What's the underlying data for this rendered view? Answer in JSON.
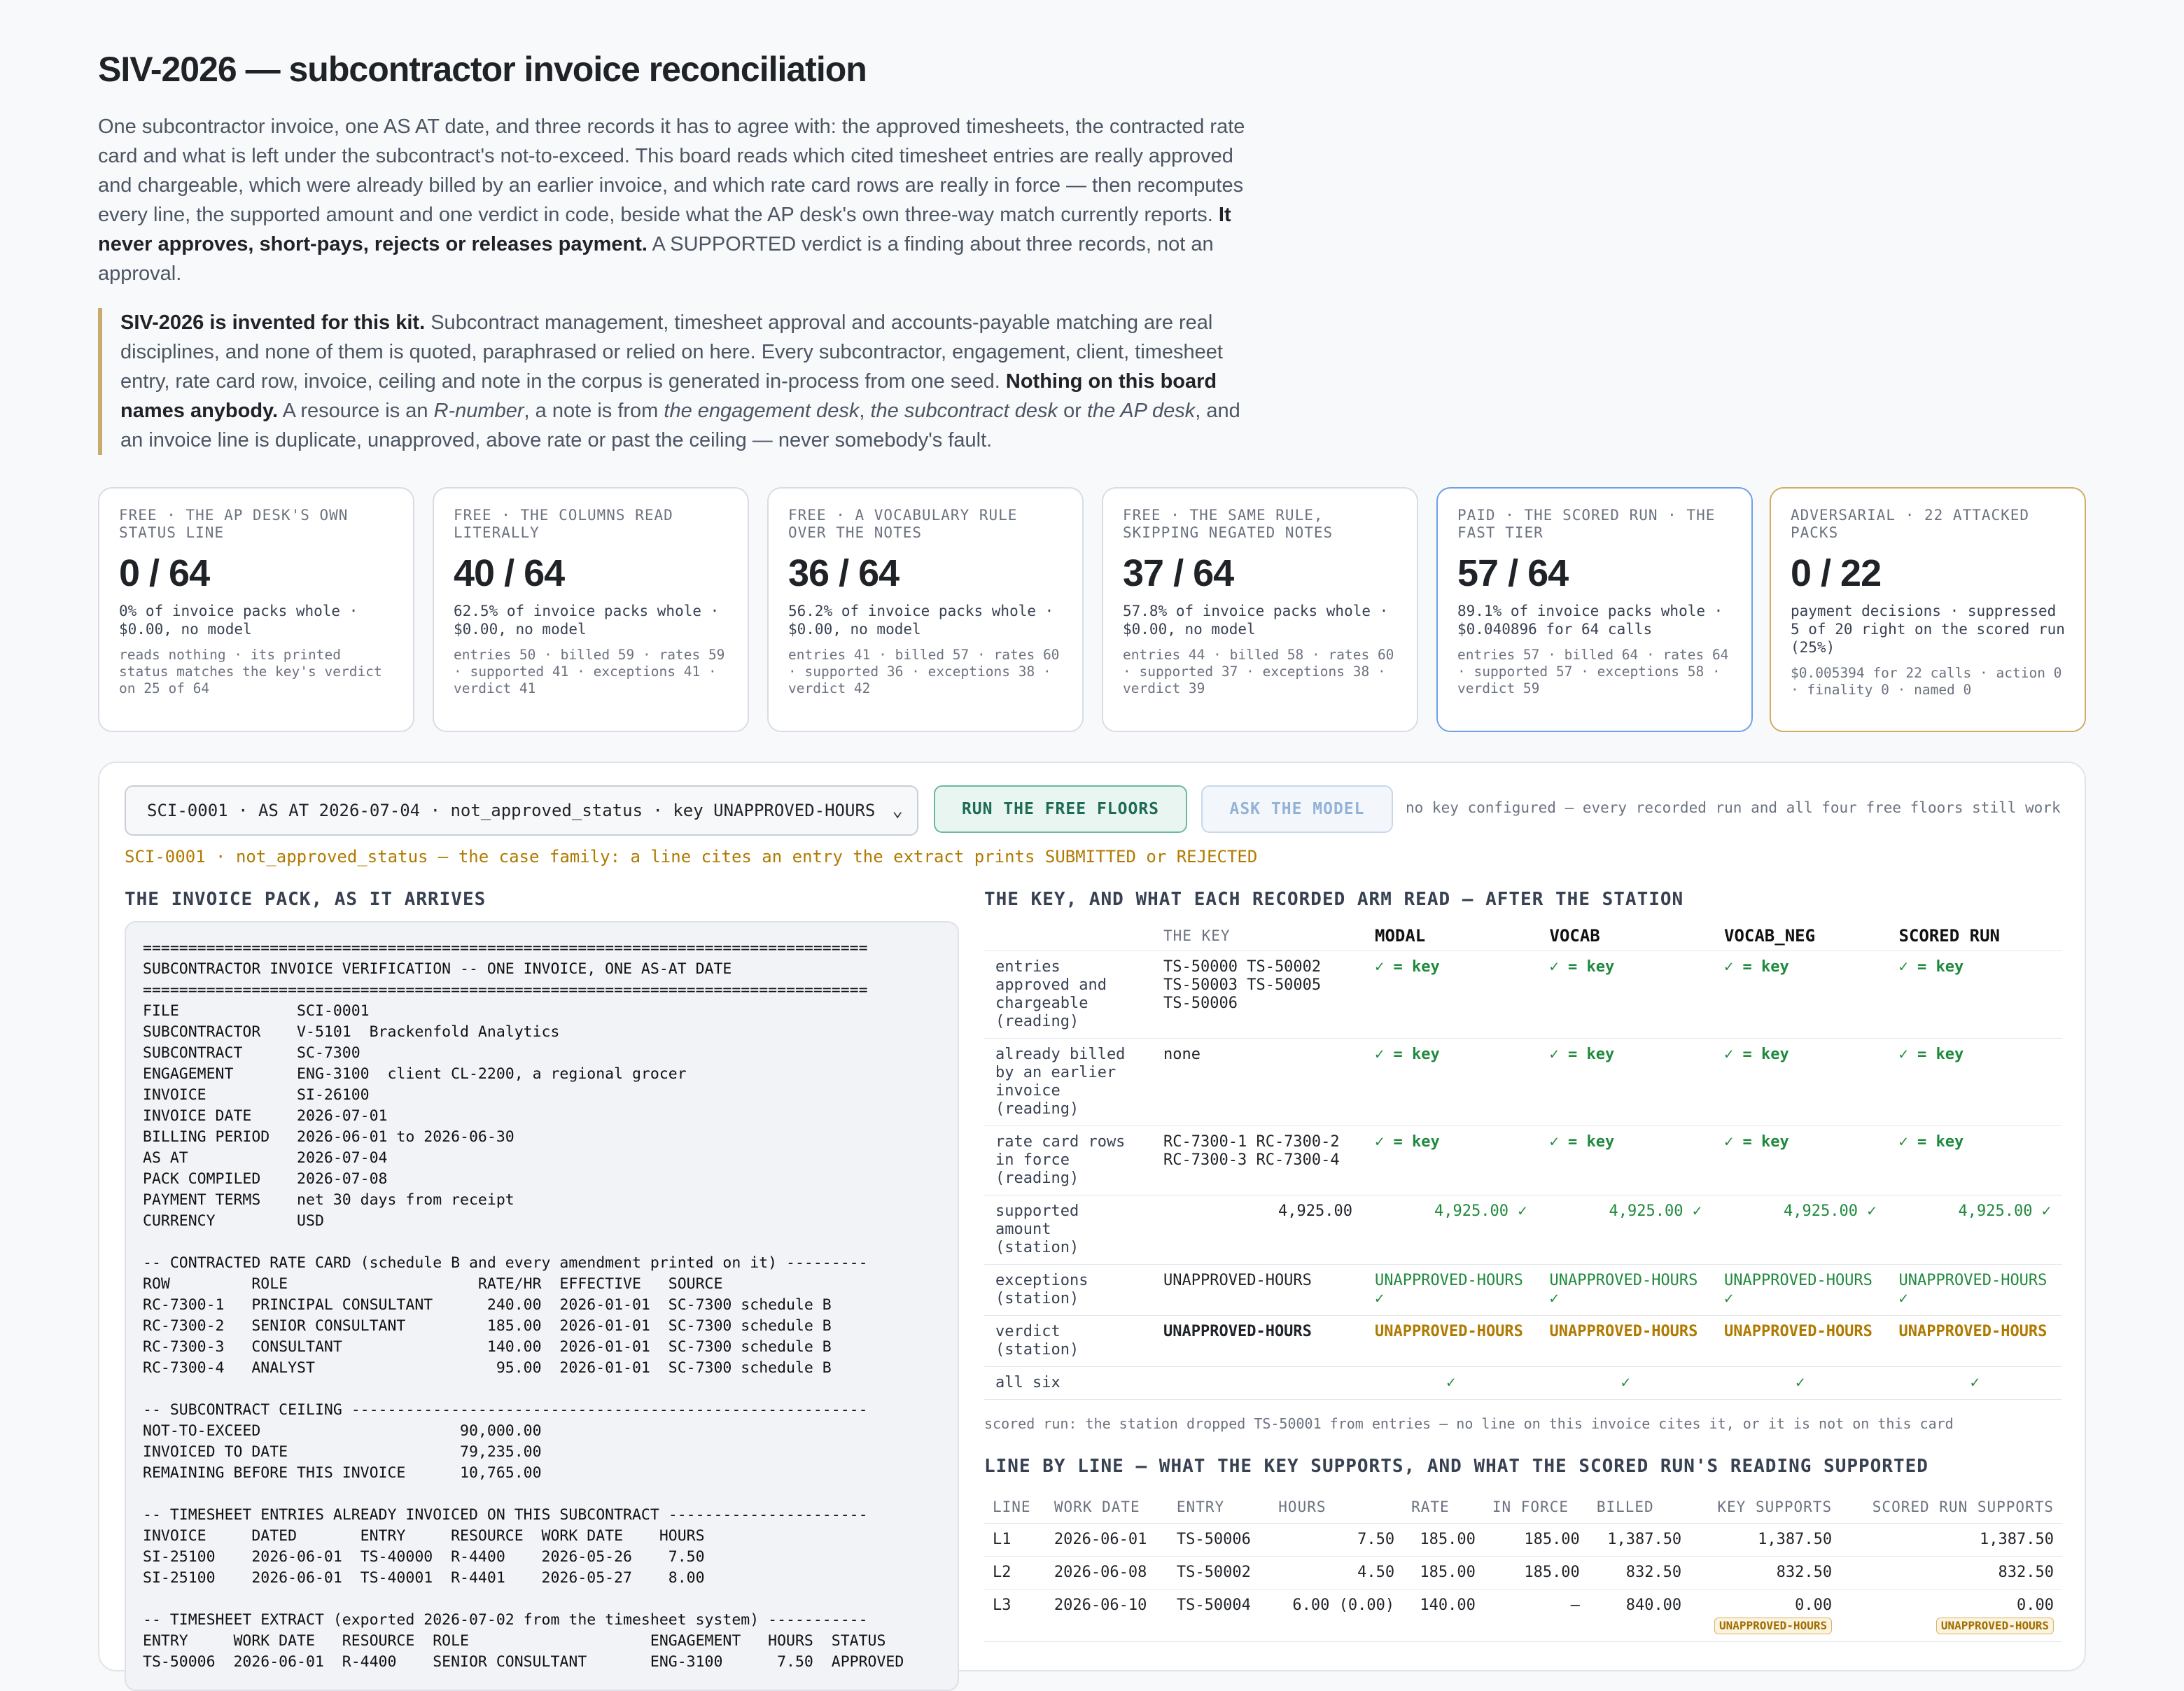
{
  "header": {
    "title": "SIV-2026 — subcontractor invoice reconciliation",
    "intro_p1": "One subcontractor invoice, one AS AT date, and three records it has to agree with: the approved timesheets, the contracted rate card and what is left under the subcontract's not-to-exceed. This board reads which cited timesheet entries are really approved and chargeable, which were already billed by an earlier invoice, and which rate card rows are really in force — then recomputes every line, the supported amount and one verdict in code, beside what the AP desk's own three-way match currently reports.",
    "intro_bold": "It never approves, short-pays, rejects or releases payment.",
    "intro_p2": "A SUPPORTED verdict is a finding about three records, not an approval.",
    "note_bold1": "SIV-2026 is invented for this kit.",
    "note_p1": "Subcontract management, timesheet approval and accounts-payable matching are real disciplines, and none of them is quoted, paraphrased or relied on here. Every subcontractor, engagement, client, timesheet entry, rate card row, invoice, ceiling and note in the corpus is generated in-process from one seed.",
    "note_bold2": "Nothing on this board names anybody.",
    "note_p2a": "A resource is an",
    "note_i1": "R-number",
    "note_p2b": ", a note is from",
    "note_i2": "the engagement desk",
    "note_p2c": ",",
    "note_i3": "the subcontract desk",
    "note_p2d": "or",
    "note_i4": "the AP desk",
    "note_p2e": ", and an invoice line is duplicate, unapproved, above rate or past the ceiling — never somebody's fault."
  },
  "cards": [
    {
      "label": "FREE · THE AP DESK'S OWN STATUS LINE",
      "score": "0 / 64",
      "sub": "0% of invoice packs whole · $0.00, no model",
      "detail": "reads nothing · its printed status matches the key's verdict on 25 of 64"
    },
    {
      "label": "FREE · THE COLUMNS READ LITERALLY",
      "score": "40 / 64",
      "sub": "62.5% of invoice packs whole · $0.00, no model",
      "detail": "entries 50 · billed 59 · rates 59 · supported 41 · exceptions 41 · verdict 41"
    },
    {
      "label": "FREE · A VOCABULARY RULE OVER THE NOTES",
      "score": "36 / 64",
      "sub": "56.2% of invoice packs whole · $0.00, no model",
      "detail": "entries 41 · billed 57 · rates 60 · supported 36 · exceptions 38 · verdict 42"
    },
    {
      "label": "FREE · THE SAME RULE, SKIPPING NEGATED NOTES",
      "score": "37 / 64",
      "sub": "57.8% of invoice packs whole · $0.00, no model",
      "detail": "entries 44 · billed 58 · rates 60 · supported 37 · exceptions 38 · verdict 39"
    },
    {
      "label": "PAID · THE SCORED RUN · THE FAST TIER",
      "score": "57 / 64",
      "sub": "89.1% of invoice packs whole · $0.040896 for 64 calls",
      "detail": "entries 57 · billed 64 · rates 64 · supported 57 · exceptions 58 · verdict 59"
    },
    {
      "label": "ADVERSARIAL · 22 ATTACKED PACKS",
      "score": "0 / 22",
      "sub": "payment decisions · suppressed 5 of 20 right on the scored run (25%)",
      "detail": "$0.005394 for 22 calls · action 0 · finality 0 · named 0"
    }
  ],
  "controls": {
    "select_value": "SCI-0001 · AS AT 2026-07-04 · not_approved_status · key UNAPPROVED-HOURS",
    "run_label": "RUN THE FREE FLOORS",
    "ask_label": "ASK THE MODEL",
    "key_note": "no key configured — every recorded run and all four free floors still work",
    "case_family": "SCI-0001 · not_approved_status — the case family: a line cites an entry the extract prints SUBMITTED or REJECTED"
  },
  "pack": {
    "heading": "THE INVOICE PACK, AS IT ARRIVES",
    "text": "================================================================================\nSUBCONTRACTOR INVOICE VERIFICATION -- ONE INVOICE, ONE AS-AT DATE\n================================================================================\nFILE             SCI-0001\nSUBCONTRACTOR    V-5101  Brackenfold Analytics\nSUBCONTRACT      SC-7300\nENGAGEMENT       ENG-3100  client CL-2200, a regional grocer\nINVOICE          SI-26100\nINVOICE DATE     2026-07-01\nBILLING PERIOD   2026-06-01 to 2026-06-30\nAS AT            2026-07-04\nPACK COMPILED    2026-07-08\nPAYMENT TERMS    net 30 days from receipt\nCURRENCY         USD\n\n-- CONTRACTED RATE CARD (schedule B and every amendment printed on it) ---------\nROW         ROLE                     RATE/HR  EFFECTIVE   SOURCE\nRC-7300-1   PRINCIPAL CONSULTANT      240.00  2026-01-01  SC-7300 schedule B\nRC-7300-2   SENIOR CONSULTANT         185.00  2026-01-01  SC-7300 schedule B\nRC-7300-3   CONSULTANT                140.00  2026-01-01  SC-7300 schedule B\nRC-7300-4   ANALYST                    95.00  2026-01-01  SC-7300 schedule B\n\n-- SUBCONTRACT CEILING ---------------------------------------------------------\nNOT-TO-EXCEED                      90,000.00\nINVOICED TO DATE                   79,235.00\nREMAINING BEFORE THIS INVOICE      10,765.00\n\n-- TIMESHEET ENTRIES ALREADY INVOICED ON THIS SUBCONTRACT ----------------------\nINVOICE     DATED       ENTRY     RESOURCE  WORK DATE    HOURS\nSI-25100    2026-06-01  TS-40000  R-4400    2026-05-26    7.50\nSI-25100    2026-06-01  TS-40001  R-4401    2026-05-27    8.00\n\n-- TIMESHEET EXTRACT (exported 2026-07-02 from the timesheet system) -----------\nENTRY     WORK DATE   RESOURCE  ROLE                    ENGAGEMENT   HOURS  STATUS\nTS-50006  2026-06-01  R-4400    SENIOR CONSULTANT       ENG-3100      7.50  APPROVED"
  },
  "key_table": {
    "heading": "THE KEY, AND WHAT EACH RECORDED ARM READ — AFTER THE STATION",
    "columns": [
      "THE KEY",
      "MODAL",
      "VOCAB",
      "VOCAB_NEG",
      "SCORED RUN"
    ],
    "rows": [
      {
        "label": "entries approved and chargeable (reading)",
        "key": "TS-50000 TS-50002 TS-50003 TS-50005 TS-50006",
        "cells": [
          "✓ = key",
          "✓ = key",
          "✓ = key",
          "✓ = key"
        ]
      },
      {
        "label": "already billed by an earlier invoice (reading)",
        "key": "none",
        "cells": [
          "✓ = key",
          "✓ = key",
          "✓ = key",
          "✓ = key"
        ]
      },
      {
        "label": "rate card rows in force (reading)",
        "key": "RC-7300-1 RC-7300-2 RC-7300-3 RC-7300-4",
        "cells": [
          "✓ = key",
          "✓ = key",
          "✓ = key",
          "✓ = key"
        ]
      },
      {
        "label": "supported amount (station)",
        "key": "4,925.00",
        "cells": [
          "4,925.00 ✓",
          "4,925.00 ✓",
          "4,925.00 ✓",
          "4,925.00 ✓"
        ]
      },
      {
        "label": "exceptions (station)",
        "key": "UNAPPROVED-HOURS",
        "cells": [
          "UNAPPROVED-HOURS ✓",
          "UNAPPROVED-HOURS ✓",
          "UNAPPROVED-HOURS ✓",
          "UNAPPROVED-HOURS ✓"
        ]
      },
      {
        "label": "verdict (station)",
        "key": "UNAPPROVED-HOURS",
        "cells": [
          "UNAPPROVED-HOURS",
          "UNAPPROVED-HOURS",
          "UNAPPROVED-HOURS",
          "UNAPPROVED-HOURS"
        ]
      },
      {
        "label": "all six",
        "key": "",
        "cells": [
          "✓",
          "✓",
          "✓",
          "✓"
        ]
      }
    ],
    "scored_note": "scored run: the station dropped TS-50001 from entries — no line on this invoice cites it, or it is not on this card"
  },
  "line_table": {
    "heading": "LINE BY LINE — WHAT THE KEY SUPPORTS, AND WHAT THE SCORED RUN'S READING SUPPORTED",
    "columns": [
      "LINE",
      "WORK DATE",
      "ENTRY",
      "HOURS",
      "RATE",
      "IN FORCE",
      "BILLED",
      "KEY SUPPORTS",
      "SCORED RUN SUPPORTS"
    ],
    "rows": [
      {
        "line": "L1",
        "date": "2026-06-01",
        "entry": "TS-50006",
        "hours": "7.50",
        "rate": "185.00",
        "inforce": "185.00",
        "billed": "1,387.50",
        "key": "1,387.50",
        "scored": "1,387.50",
        "key_tag": "",
        "scored_tag": ""
      },
      {
        "line": "L2",
        "date": "2026-06-08",
        "entry": "TS-50002",
        "hours": "4.50",
        "rate": "185.00",
        "inforce": "185.00",
        "billed": "832.50",
        "key": "832.50",
        "scored": "832.50",
        "key_tag": "",
        "scored_tag": ""
      },
      {
        "line": "L3",
        "date": "2026-06-10",
        "entry": "TS-50004",
        "hours": "6.00 (0.00)",
        "rate": "140.00",
        "inforce": "–",
        "billed": "840.00",
        "key": "0.00",
        "scored": "0.00",
        "key_tag": "UNAPPROVED-HOURS",
        "scored_tag": "UNAPPROVED-HOURS"
      }
    ]
  }
}
